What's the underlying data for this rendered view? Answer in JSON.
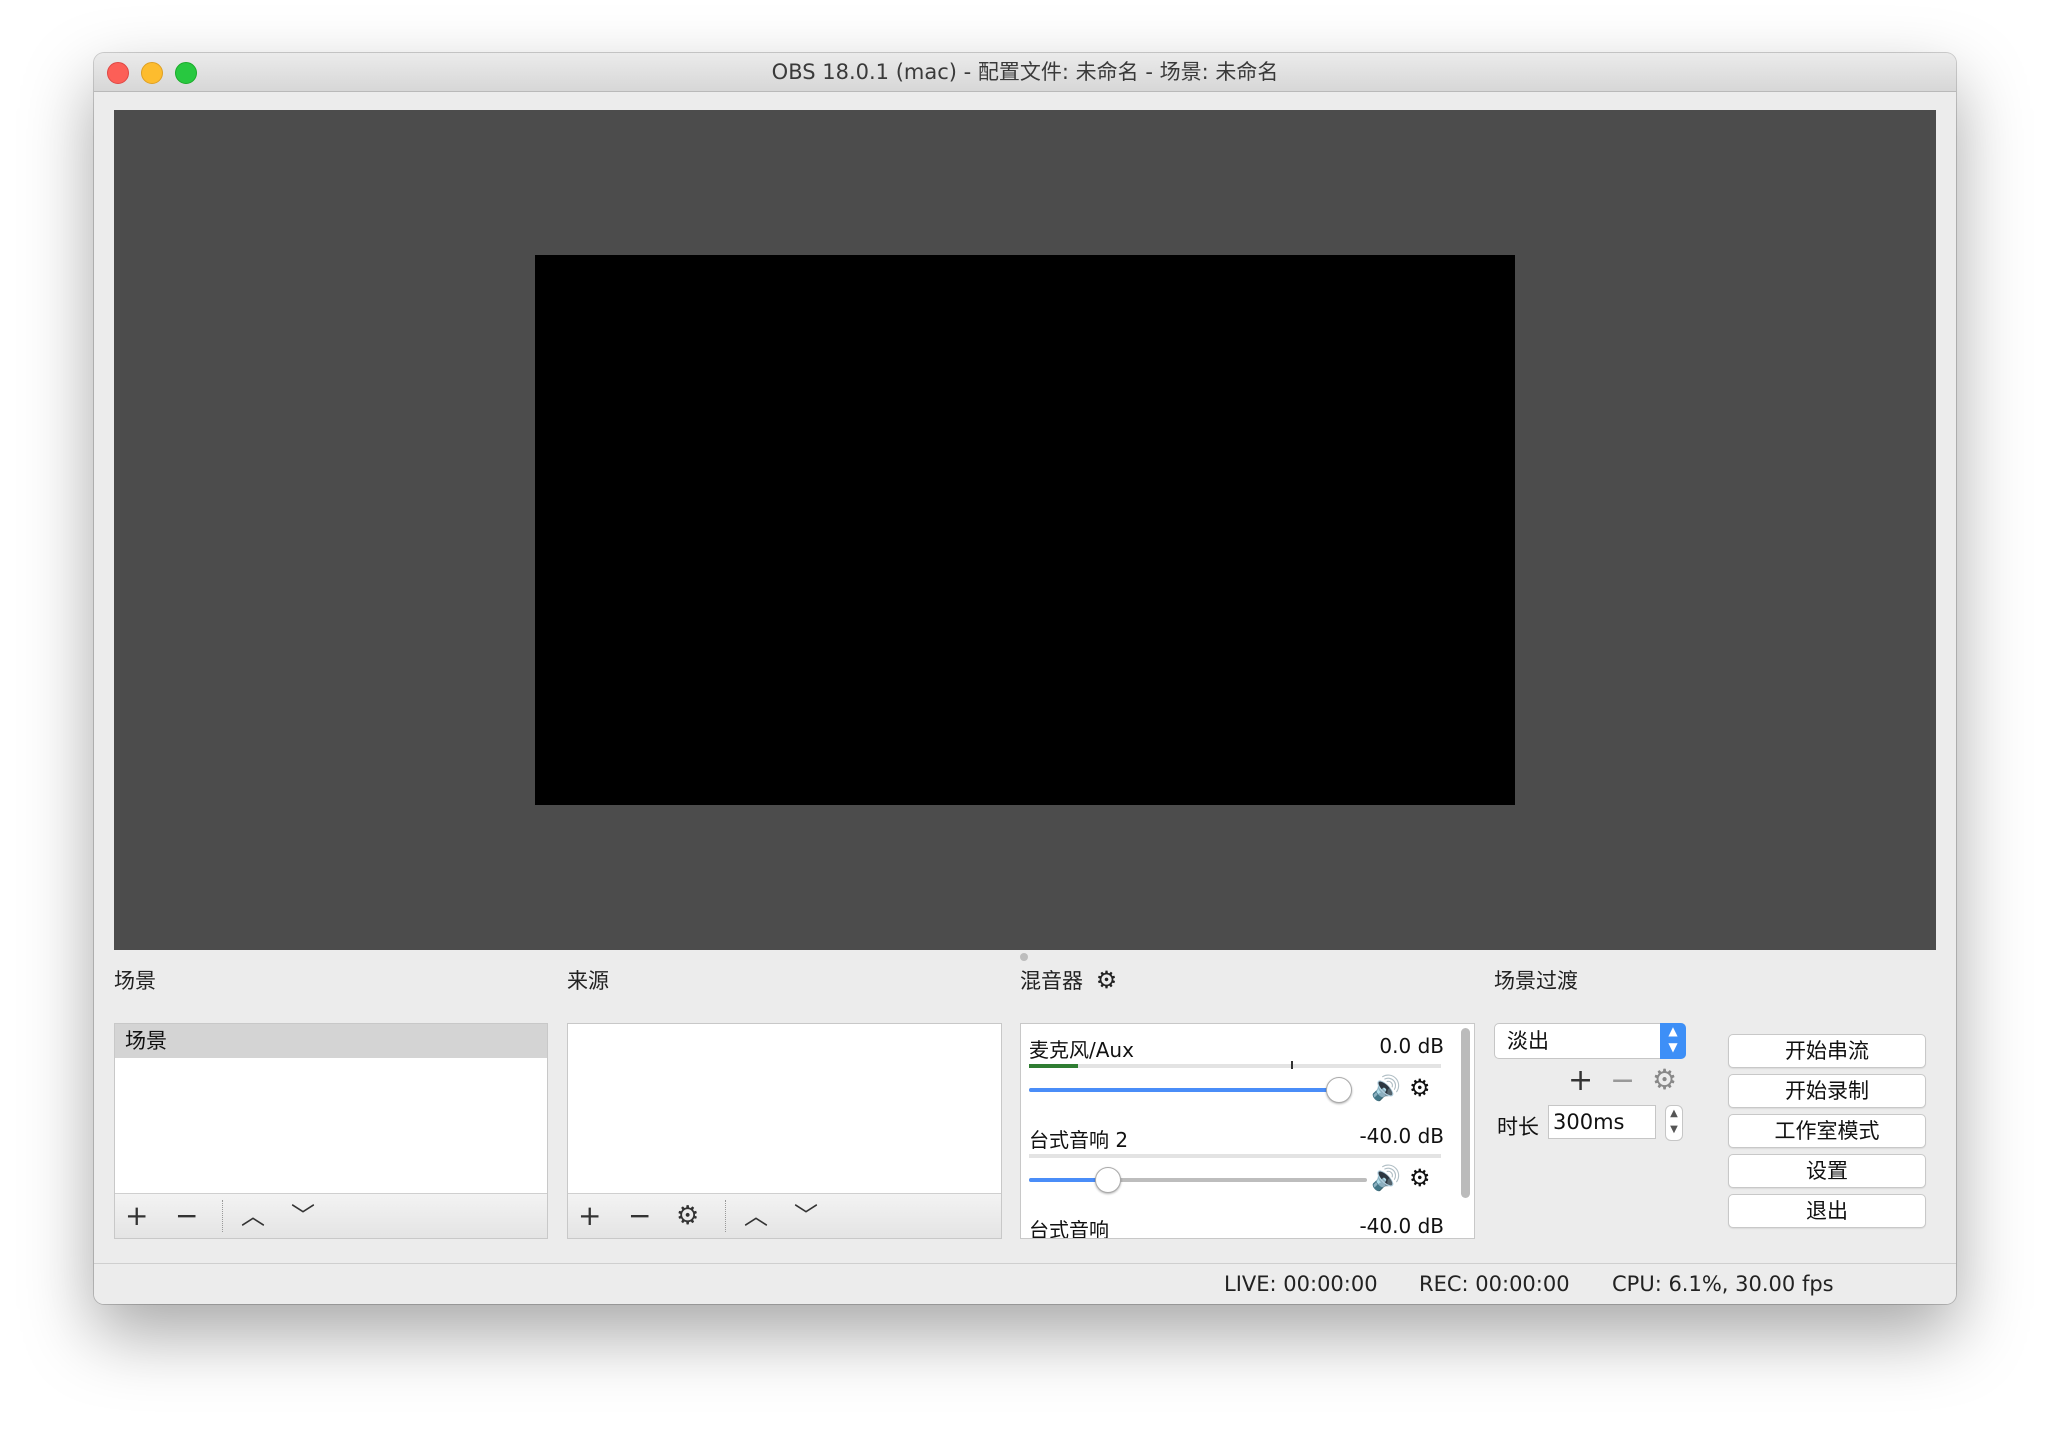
{
  "window": {
    "title": "OBS 18.0.1 (mac) - 配置文件: 未命名 - 场景: 未命名"
  },
  "scenes": {
    "title": "场景",
    "items": [
      "场景"
    ]
  },
  "sources": {
    "title": "来源"
  },
  "mixer": {
    "title": "混音器",
    "channels": [
      {
        "name": "麦克风/Aux",
        "db": "0.0 dB",
        "meter": 0.12,
        "volume": 0.96
      },
      {
        "name": "台式音响 2",
        "db": "-40.0 dB",
        "meter": 0.0,
        "volume": 0.23
      },
      {
        "name": "台式音响",
        "db": "-40.0 dB"
      }
    ]
  },
  "transitions": {
    "title": "场景过渡",
    "selected": "淡出",
    "duration_label": "时长",
    "duration_value": "300ms"
  },
  "controls": {
    "start_streaming": "开始串流",
    "start_recording": "开始录制",
    "studio_mode": "工作室模式",
    "settings": "设置",
    "exit": "退出"
  },
  "status": {
    "live": "LIVE: 00:00:00",
    "rec": "REC: 00:00:00",
    "cpu": "CPU: 6.1%, 30.00 fps"
  },
  "colors": {
    "preview_bg": "#4c4c4c",
    "canvas": "#000000",
    "accent": "#3d8ff7",
    "meter": "#2f7d32"
  }
}
